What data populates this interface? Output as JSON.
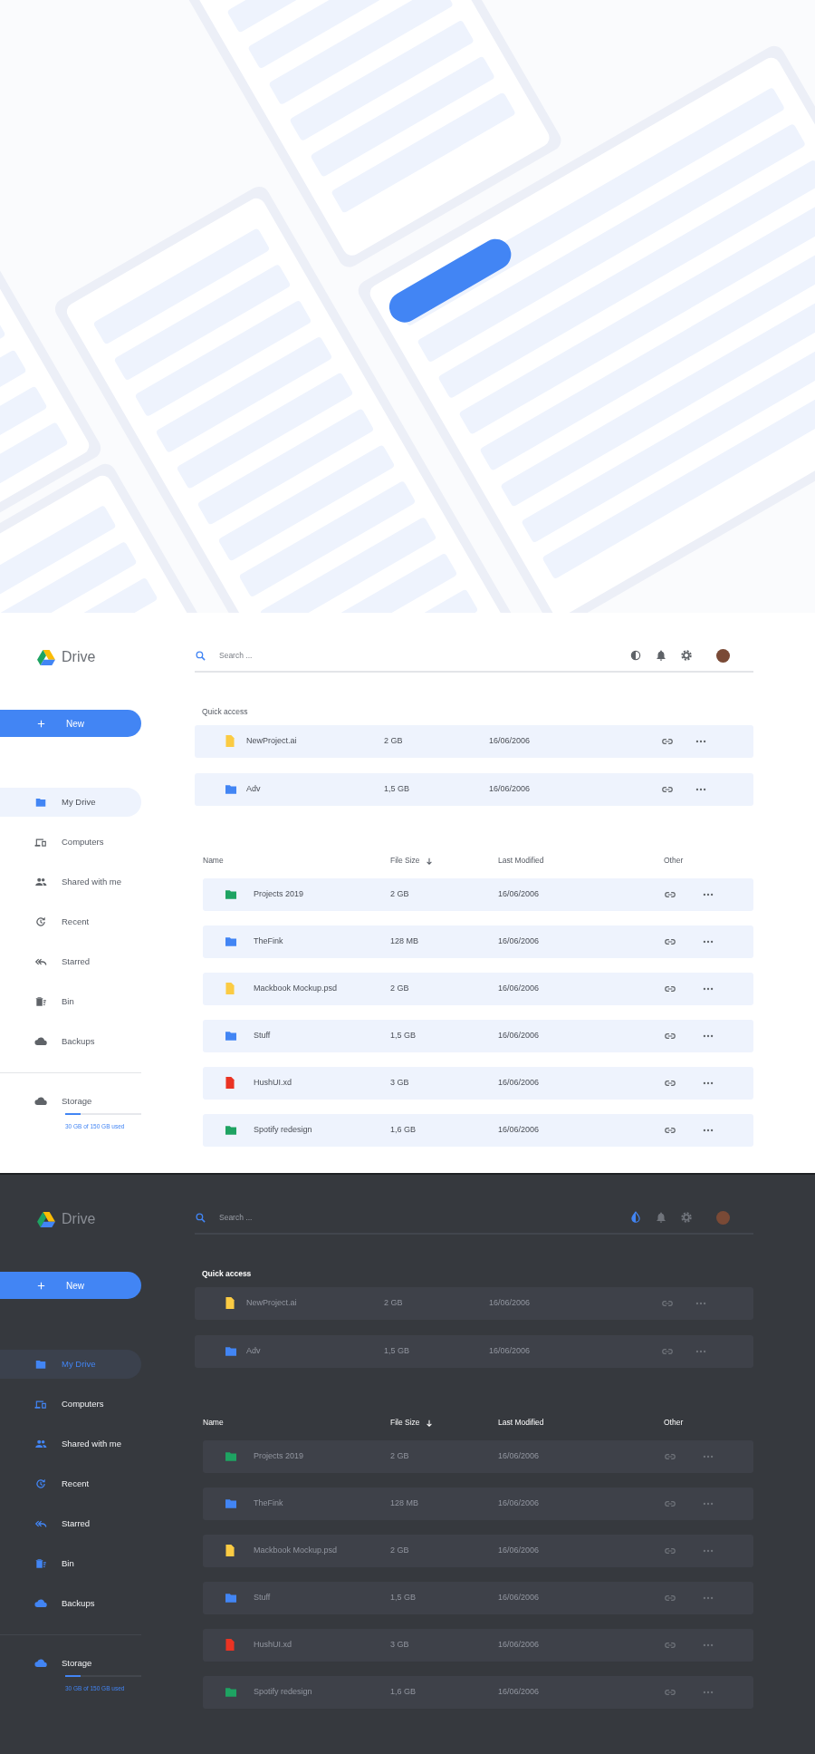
{
  "screens": [
    {
      "dark": false,
      "logo": "Drive",
      "search": {
        "placeholder": "Search ..."
      },
      "new_button": "New",
      "nav": [
        {
          "label": "My Drive",
          "selected": true
        },
        {
          "label": "Computers",
          "selected": false
        },
        {
          "label": "Shared with me",
          "selected": false
        },
        {
          "label": "Recent",
          "selected": false
        },
        {
          "label": "Starred",
          "selected": false
        },
        {
          "label": "Bin",
          "selected": false
        },
        {
          "label": "Backups",
          "selected": false
        }
      ],
      "storage": {
        "label": "Storage",
        "level": 0.2,
        "used": "30 GB of 150 GB used"
      },
      "quick_access": {
        "title": "Quick access",
        "rows": [
          {
            "kind": "file",
            "color": "#fbcb43",
            "name": "NewProject.ai",
            "size": "2 GB",
            "modified": "16/06/2006"
          },
          {
            "kind": "folder",
            "color": "#4285f4",
            "name": "Adv",
            "size": "1,5 GB",
            "modified": "16/06/2006"
          }
        ]
      },
      "files": {
        "columns": [
          {
            "label": "Name",
            "sorted": false
          },
          {
            "label": "File Size",
            "sorted": true
          },
          {
            "label": "Last Modified",
            "sorted": false
          },
          {
            "label": "Other",
            "sorted": false
          }
        ],
        "rows": [
          {
            "kind": "folder",
            "color": "#1ea362",
            "name": "Projects 2019",
            "size": "2 GB",
            "modified": "16/06/2006"
          },
          {
            "kind": "folder",
            "color": "#4285f4",
            "name": "TheFink",
            "size": "128 MB",
            "modified": "16/06/2006"
          },
          {
            "kind": "file",
            "color": "#fbcb43",
            "name": "Mackbook Mockup.psd",
            "size": "2 GB",
            "modified": "16/06/2006"
          },
          {
            "kind": "folder",
            "color": "#4285f4",
            "name": "Stuff",
            "size": "1,5 GB",
            "modified": "16/06/2006"
          },
          {
            "kind": "file",
            "color": "#ea3323",
            "name": "HushUI.xd",
            "size": "3 GB",
            "modified": "16/06/2006"
          },
          {
            "kind": "folder",
            "color": "#1ea362",
            "name": "Spotify redesign",
            "size": "1,6 GB",
            "modified": "16/06/2006"
          }
        ]
      }
    },
    {
      "dark": true,
      "logo": "Drive",
      "search": {
        "placeholder": "Search ..."
      },
      "new_button": "New",
      "nav": [
        {
          "label": "My Drive",
          "selected": true
        },
        {
          "label": "Computers",
          "selected": false
        },
        {
          "label": "Shared with me",
          "selected": false
        },
        {
          "label": "Recent",
          "selected": false
        },
        {
          "label": "Starred",
          "selected": false
        },
        {
          "label": "Bin",
          "selected": false
        },
        {
          "label": "Backups",
          "selected": false
        }
      ],
      "storage": {
        "label": "Storage",
        "level": 0.2,
        "used": "30 GB of 150 GB used"
      },
      "quick_access": {
        "title": "Quick access",
        "rows": [
          {
            "kind": "file",
            "color": "#fbcb43",
            "name": "NewProject.ai",
            "size": "2 GB",
            "modified": "16/06/2006"
          },
          {
            "kind": "folder",
            "color": "#4285f4",
            "name": "Adv",
            "size": "1,5 GB",
            "modified": "16/06/2006"
          }
        ]
      },
      "files": {
        "columns": [
          {
            "label": "Name",
            "sorted": false
          },
          {
            "label": "File Size",
            "sorted": true
          },
          {
            "label": "Last Modified",
            "sorted": false
          },
          {
            "label": "Other",
            "sorted": false
          }
        ],
        "rows": [
          {
            "kind": "folder",
            "color": "#1ea362",
            "name": "Projects 2019",
            "size": "2 GB",
            "modified": "16/06/2006"
          },
          {
            "kind": "folder",
            "color": "#4285f4",
            "name": "TheFink",
            "size": "128 MB",
            "modified": "16/06/2006"
          },
          {
            "kind": "file",
            "color": "#fbcb43",
            "name": "Mackbook Mockup.psd",
            "size": "2 GB",
            "modified": "16/06/2006"
          },
          {
            "kind": "folder",
            "color": "#4285f4",
            "name": "Stuff",
            "size": "1,5 GB",
            "modified": "16/06/2006"
          },
          {
            "kind": "file",
            "color": "#ea3323",
            "name": "HushUI.xd",
            "size": "3 GB",
            "modified": "16/06/2006"
          },
          {
            "kind": "folder",
            "color": "#1ea362",
            "name": "Spotify redesign",
            "size": "1,6 GB",
            "modified": "16/06/2006"
          }
        ]
      }
    }
  ]
}
